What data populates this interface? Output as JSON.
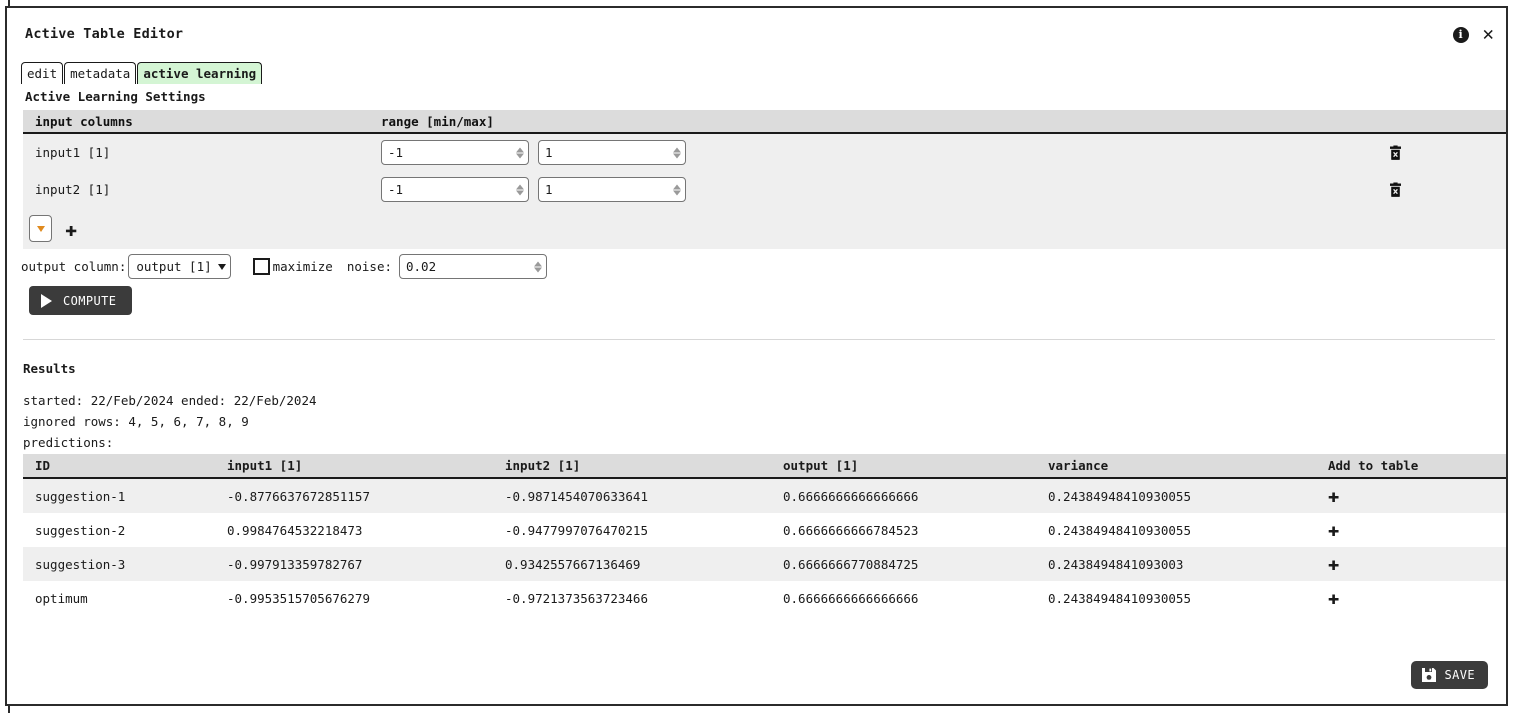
{
  "window": {
    "title": "Active Table Editor",
    "info_icon": "info-icon",
    "close_icon": "close-icon"
  },
  "tabs": [
    {
      "label": "edit",
      "active": false
    },
    {
      "label": "metadata",
      "active": false
    },
    {
      "label": "active learning",
      "active": true
    }
  ],
  "settings": {
    "section_title": "Active Learning Settings",
    "headers": {
      "col1": "input columns",
      "col2": "range [min/max]"
    },
    "rows": [
      {
        "name": "input1 [1]",
        "min": "-1",
        "max": "1",
        "delete_icon": "trash-icon"
      },
      {
        "name": "input2 [1]",
        "min": "-1",
        "max": "1",
        "delete_icon": "trash-icon"
      }
    ],
    "add_row": {
      "dropdown_icon": "chevron-down-icon",
      "add_icon": "plus-icon"
    }
  },
  "output_row": {
    "output_column_label": "output column:",
    "output_column_value": "output [1]",
    "maximize_label": "maximize",
    "maximize_checked": false,
    "noise_label": "noise:",
    "noise_value": "0.02"
  },
  "compute_button": {
    "label": "COMPUTE",
    "icon": "play-icon"
  },
  "results": {
    "title": "Results",
    "started_line": "started: 22/Feb/2024  ended: 22/Feb/2024",
    "ignored_line": "ignored rows: 4, 5, 6, 7, 8, 9",
    "predictions_label": "predictions:",
    "headers": [
      "ID",
      "input1 [1]",
      "input2 [1]",
      "output [1]",
      "variance",
      "Add to table"
    ],
    "rows": [
      {
        "id": "suggestion-1",
        "input1": "-0.8776637672851157",
        "input2": "-0.9871454070633641",
        "output": "0.6666666666666666",
        "variance": "0.24384948410930055",
        "add_icon": "plus-icon"
      },
      {
        "id": "suggestion-2",
        "input1": "0.9984764532218473",
        "input2": "-0.9477997076470215",
        "output": "0.6666666666784523",
        "variance": "0.24384948410930055",
        "add_icon": "plus-icon"
      },
      {
        "id": "suggestion-3",
        "input1": "-0.997913359782767",
        "input2": "0.9342557667136469",
        "output": "0.6666666770884725",
        "variance": "0.2438494841093003",
        "add_icon": "plus-icon"
      },
      {
        "id": "optimum",
        "input1": "-0.9953515705676279",
        "input2": "-0.9721373563723466",
        "output": "0.6666666666666666",
        "variance": "0.24384948410930055",
        "add_icon": "plus-icon"
      }
    ]
  },
  "save_button": {
    "label": "SAVE",
    "icon": "floppy-disk-icon"
  },
  "colors": {
    "active_tab_bg": "#d4f5d4",
    "button_bg": "#3b3b3b",
    "header_bg": "#dcdcdc",
    "zebra_bg": "#efefef",
    "accent_orange": "#e08a1e"
  }
}
